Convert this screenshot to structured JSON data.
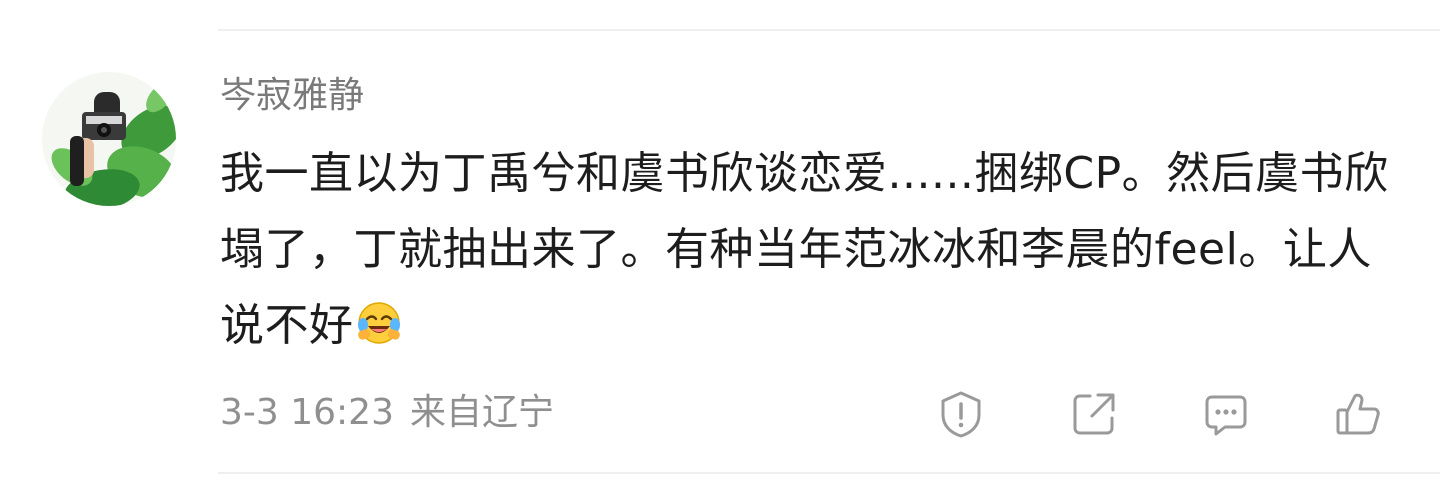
{
  "comment": {
    "username": "岑寂雅静",
    "text": "我一直以为丁禹兮和虞书欣谈恋爱......捆绑CP。然后虞书欣塌了，丁就抽出来了。有种当年范冰冰和李晨的feel。让人说不好",
    "emoji": "laughing-crying-emoji",
    "timestamp": "3-3 16:23",
    "location": "来自辽宁"
  },
  "actions": [
    {
      "name": "report",
      "icon": "shield-exclamation-icon"
    },
    {
      "name": "share",
      "icon": "share-arrow-icon"
    },
    {
      "name": "reply",
      "icon": "comment-bubble-icon"
    },
    {
      "name": "like",
      "icon": "thumbs-up-icon"
    }
  ],
  "colors": {
    "text_primary": "#1d1d1d",
    "text_secondary": "#7a7a7a",
    "icon_gray": "#9a9a9a",
    "divider": "#efefef"
  }
}
